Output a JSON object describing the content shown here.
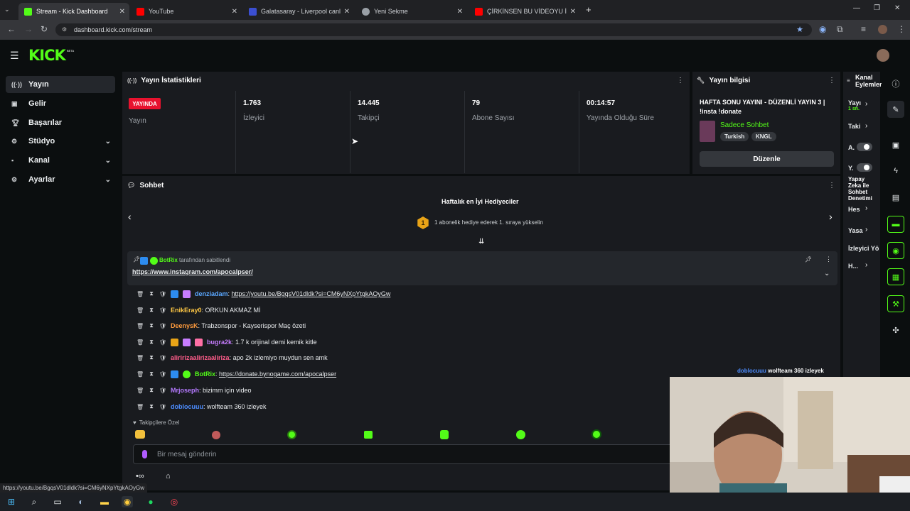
{
  "browser": {
    "tabs": [
      {
        "title": "Stream - Kick Dashboard",
        "color": "#53fc18"
      },
      {
        "title": "YouTube",
        "color": "#ff0000"
      },
      {
        "title": "Galatasaray - Liverpool canlı sk",
        "color": "#3b4fd1"
      },
      {
        "title": "Yeni Sekme",
        "color": "#9aa0a6"
      },
      {
        "title": "ÇİRKİNSEN BU VİDEOYU İZLE.",
        "color": "#ff0000"
      }
    ],
    "url": "dashboard.kick.com/stream",
    "status_url": "https://youtu.be/BgqsV01dldk?si=CM6yNXpYtgkAOyGw"
  },
  "header": {
    "logo": "KICK",
    "logo_badge": "BETA"
  },
  "sidebar": {
    "items": [
      {
        "label": "Yayın",
        "icon": "broadcast-icon"
      },
      {
        "label": "Gelir",
        "icon": "wallet-icon"
      },
      {
        "label": "Başarılar",
        "icon": "trophy-icon"
      },
      {
        "label": "Stüdyo",
        "icon": "gear-icon"
      },
      {
        "label": "Kanal",
        "icon": "user-icon"
      },
      {
        "label": "Ayarlar",
        "icon": "gear-icon"
      }
    ]
  },
  "stats": {
    "title": "Yayın İstatistikleri",
    "live_badge": "YAYINDA",
    "live_label": "Yayın",
    "viewers_value": "1.763",
    "viewers_label": "İzleyici",
    "followers_value": "14.445",
    "followers_label": "Takipçi",
    "subs_value": "79",
    "subs_label": "Abone Sayısı",
    "duration_value": "00:14:57",
    "duration_label": "Yayında Olduğu Süre"
  },
  "stream_info": {
    "title": "Yayın bilgisi",
    "stream_title": "HAFTA SONU YAYINI - DÜZENLİ YAYIN 3 | !insta !donate",
    "category": "Sadece Sohbet",
    "tags": [
      "Turkish",
      "KNGL"
    ],
    "edit_button": "Düzenle"
  },
  "chat": {
    "title": "Sohbet",
    "gifters_title": "Haftalık en İyi Hediyeciler",
    "gifters_rank": "1",
    "gifters_text": "1 abonelik hediye ederek 1. sıraya yükselin",
    "pinned_by_user": "BotRix",
    "pinned_by_suffix": "tarafından sabitlendi",
    "pinned_link": "https://www.instagram.com/apocalpser/",
    "messages": [
      {
        "user": "denziadam",
        "color": "#5aa7ff",
        "text": "",
        "link": "https://youtu.be/BgqsV01dldk?si=CM6yNXpYtgkAOyGw"
      },
      {
        "user": "EnikEray0",
        "color": "#ffc845",
        "text": "ORKUN AKMAZ Mİ",
        "link": ""
      },
      {
        "user": "DeenysK",
        "color": "#ff9b3d",
        "text": "Trabzonspor - Kayserispor Maç özeti",
        "link": ""
      },
      {
        "user": "bugra2k",
        "color": "#c77dff",
        "text": "1.7 k orijinal demi kemik kitle",
        "link": ""
      },
      {
        "user": "aliririzaalirizaaliriza",
        "color": "#ff5c8a",
        "text": "apo 2k izlemiyo muydun sen amk",
        "link": ""
      },
      {
        "user": "BotRix",
        "color": "#53fc18",
        "text": "",
        "link": "https://donate.bynogame.com/apocalpser"
      },
      {
        "user": "Mrjoseph",
        "color": "#b57aff",
        "text": "bizimm için video",
        "link": ""
      },
      {
        "user": "doblocuuu",
        "color": "#4d8dff",
        "text": "wolfteam 360 izleyek",
        "link": ""
      }
    ],
    "overlay_user": "doblocuuu",
    "overlay_text": "wolfteam 360 izleyek",
    "followers_only": "Takipçilere Özel",
    "input_placeholder": "Bir mesaj gönderin"
  },
  "channel_actions": {
    "title": "Kanal Eylemleri",
    "items": [
      {
        "label": "Yayı",
        "sub": "1 sn."
      },
      {
        "label": "Taki",
        "sub": ""
      },
      {
        "label": "A.",
        "sub": ""
      },
      {
        "label": "Y.",
        "sub": ""
      },
      {
        "label": "Yapay Zeka ile Sohbet Denetimi",
        "sub": ""
      },
      {
        "label": "Hes",
        "sub": ""
      },
      {
        "label": "Yasa",
        "sub": ""
      },
      {
        "label": "İzleyici Yö",
        "sub": ""
      },
      {
        "label": "H...",
        "sub": ""
      }
    ]
  },
  "accent": "#53fc18"
}
